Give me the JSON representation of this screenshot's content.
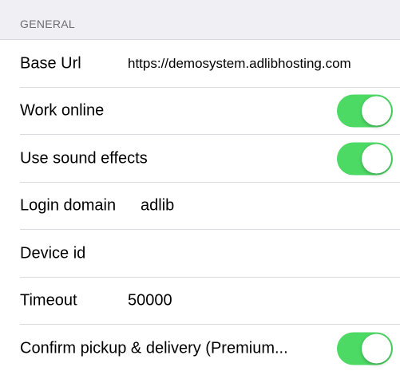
{
  "section": {
    "title": "GENERAL"
  },
  "rows": {
    "base_url": {
      "label": "Base Url",
      "value": "https://demosystem.adlibhosting.com"
    },
    "work_online": {
      "label": "Work online",
      "toggle_on": true
    },
    "sound_effects": {
      "label": "Use sound effects",
      "toggle_on": true
    },
    "login_domain": {
      "label": "Login domain",
      "value": "adlib"
    },
    "device_id": {
      "label": "Device id",
      "value": ""
    },
    "timeout": {
      "label": "Timeout",
      "value": "50000"
    },
    "confirm_pickup": {
      "label": "Confirm pickup & delivery (Premium...",
      "toggle_on": true
    }
  },
  "colors": {
    "toggle_on": "#4cd964",
    "header_background": "#efeff4",
    "header_text": "#6d6d72"
  }
}
